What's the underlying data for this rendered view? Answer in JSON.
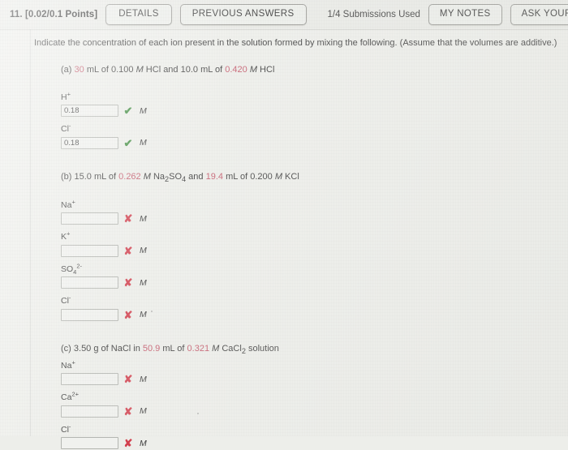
{
  "header": {
    "question_label": "11. [0.02/0.1 Points]",
    "details_button": "DETAILS",
    "previous_answers_button": "PREVIOUS ANSWERS",
    "submissions_used": "1/4 Submissions Used",
    "my_notes_button": "MY NOTES",
    "ask_your_teacher_button": "ASK YOUR TEACHER"
  },
  "prompt": "Indicate the concentration of each ion present in the solution formed by mixing the following. (Assume that the volumes are additive.)",
  "parts": {
    "a": {
      "marker": "(a)",
      "v1": "30",
      "t1": " mL of 0.100 ",
      "m1": "M",
      "t2": " HCl and 10.0 mL of ",
      "v2": "0.420",
      "m2": "M",
      "t3": " HCl",
      "ions": [
        {
          "name": "H",
          "charge": "+",
          "value": "0.18",
          "status": "correct",
          "unit": "M"
        },
        {
          "name": "Cl",
          "charge": "-",
          "value": "0.18",
          "status": "correct",
          "unit": "M"
        }
      ]
    },
    "b": {
      "marker": "(b)",
      "t0": "15.0 mL of ",
      "v1": "0.262",
      "m1": "M",
      "t1": " Na",
      "sub1": "2",
      "t2": "SO",
      "sub2": "4",
      "t3": " and ",
      "v2": "19.4",
      "t4": " mL of 0.200 ",
      "m2": "M",
      "t5": " KCl",
      "ions": [
        {
          "name": "Na",
          "charge": "+",
          "value": "",
          "status": "incorrect",
          "unit": "M"
        },
        {
          "name": "K",
          "charge": "+",
          "value": "",
          "status": "incorrect",
          "unit": "M"
        },
        {
          "name": "SO",
          "sub": "4",
          "charge": "2-",
          "value": "",
          "status": "incorrect",
          "unit": "M"
        },
        {
          "name": "Cl",
          "charge": "-",
          "value": "",
          "status": "incorrect",
          "unit": "M"
        }
      ]
    },
    "c": {
      "marker": "(c)",
      "t0": "3.50 g of NaCl in ",
      "v1": "50.9",
      "t1": " mL of ",
      "v2": "0.321",
      "m1": "M",
      "t2": " CaCl",
      "sub1": "2",
      "t3": " solution",
      "ions": [
        {
          "name": "Na",
          "charge": "+",
          "value": "",
          "status": "incorrect",
          "unit": "M"
        },
        {
          "name": "Ca",
          "charge": "2+",
          "value": "",
          "status": "incorrect",
          "unit": "M"
        },
        {
          "name": "Cl",
          "charge": "-",
          "value": "",
          "status": "incorrect",
          "unit": "M"
        }
      ]
    }
  },
  "marks": {
    "correct_glyph": "✔",
    "incorrect_glyph": "✘",
    "correct_color": "#3f8c3f",
    "incorrect_color": "#d2414f"
  },
  "colors": {
    "background": "#edeeea",
    "header_background": "#e9eae6",
    "highlight_value": "#c4596b",
    "text": "#3a3a3a"
  }
}
